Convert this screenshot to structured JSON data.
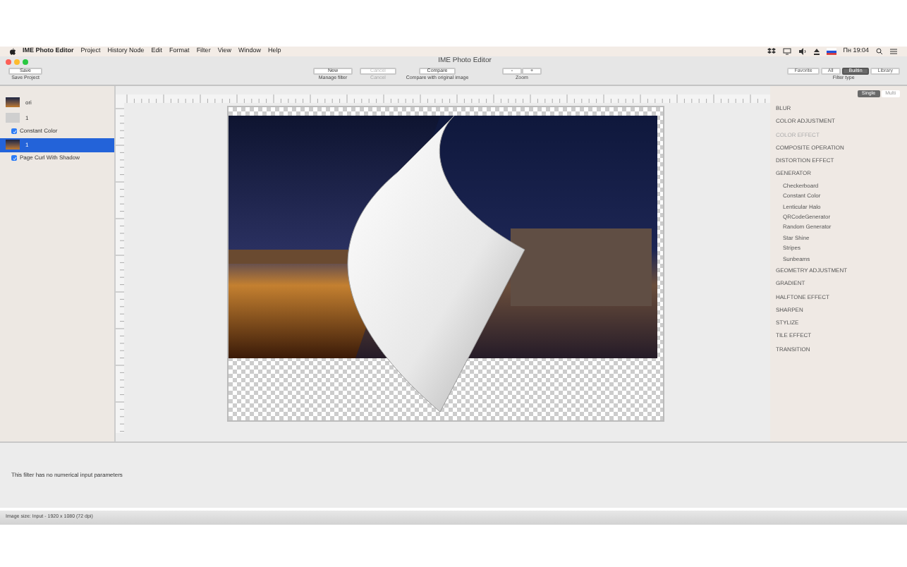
{
  "menubar": {
    "app": "IME Photo Editor",
    "items": [
      "Project",
      "History Node",
      "Edit",
      "Format",
      "Filter",
      "View",
      "Window",
      "Help"
    ],
    "clock": "Пн 19:04"
  },
  "window": {
    "title": "IME Photo Editor"
  },
  "toolbar": {
    "save": {
      "button": "Save",
      "caption": "Save Project"
    },
    "manage": {
      "button": "New",
      "caption": "Manage filter"
    },
    "cancel": {
      "button": "Cancel",
      "caption": "Cancel",
      "disabled": true
    },
    "compare": {
      "button": "Compare",
      "caption": "Compare with original image"
    },
    "zoom": {
      "buttons": [
        "-",
        "+"
      ],
      "caption": "Zoom"
    },
    "filter_type": {
      "options": [
        {
          "label": "Favorite",
          "selected": false
        },
        {
          "label": "All",
          "selected": false
        },
        {
          "label": "Builtin",
          "selected": true
        },
        {
          "label": "Library",
          "selected": false
        }
      ],
      "caption": "Filter type"
    }
  },
  "history": [
    {
      "kind": "image",
      "label": "ori",
      "selected": false
    },
    {
      "kind": "blank",
      "label": "1",
      "selected": false
    },
    {
      "kind": "filter",
      "label": "Constant Color",
      "checked": true
    },
    {
      "kind": "image",
      "label": "1",
      "selected": true
    },
    {
      "kind": "filter",
      "label": "Page Curl With Shadow",
      "checked": true
    }
  ],
  "mode": [
    {
      "label": "Single",
      "selected": true
    },
    {
      "label": "Multi",
      "selected": false
    }
  ],
  "categories": [
    {
      "label": "BLUR",
      "disabled": false
    },
    {
      "label": "COLOR ADJUSTMENT",
      "disabled": false
    },
    {
      "label": "COLOR EFFECT",
      "disabled": true
    },
    {
      "label": "COMPOSITE OPERATION",
      "disabled": false
    },
    {
      "label": "DISTORTION EFFECT",
      "disabled": false
    },
    {
      "label": "GENERATOR",
      "disabled": false,
      "children": [
        "Checkerboard",
        "Constant Color",
        "Lenticular Halo",
        "QRCodeGenerator",
        "Random Generator",
        "Star Shine",
        "Stripes",
        "Sunbeams"
      ]
    },
    {
      "label": "GEOMETRY ADJUSTMENT",
      "disabled": false
    },
    {
      "label": "GRADIENT",
      "disabled": false
    },
    {
      "label": "HALFTONE EFFECT",
      "disabled": false
    },
    {
      "label": "SHARPEN",
      "disabled": false
    },
    {
      "label": "STYLIZE",
      "disabled": false
    },
    {
      "label": "TILE EFFECT",
      "disabled": false
    },
    {
      "label": "TRANSITION",
      "disabled": false
    }
  ],
  "params": {
    "message": "This filter has no numerical input parameters"
  },
  "status_bar": "Image size: Input - 1920 x 1080 (72 dpi)"
}
